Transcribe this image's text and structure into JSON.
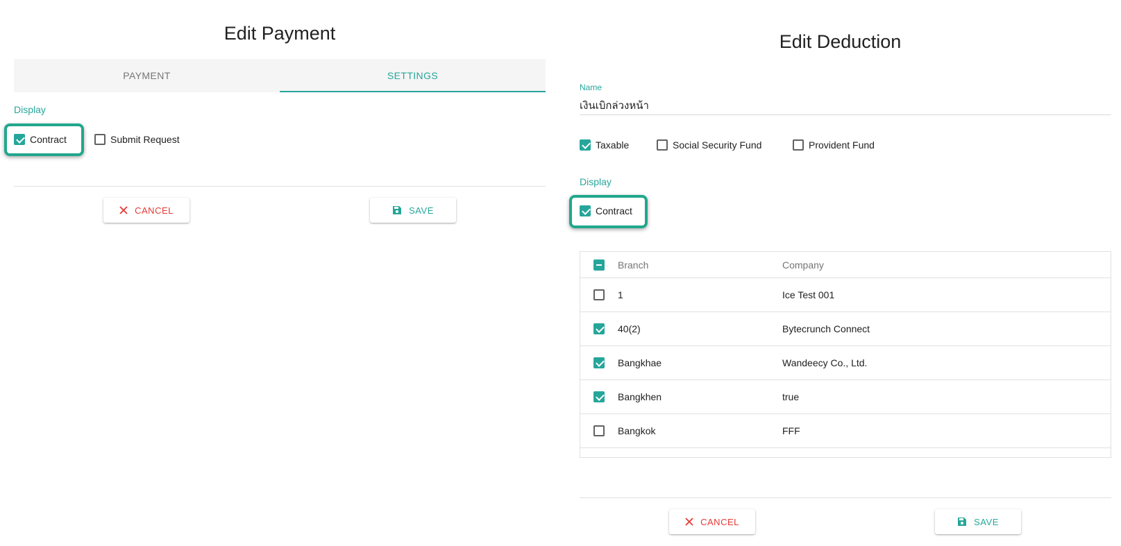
{
  "left": {
    "title": "Edit Payment",
    "tabs": [
      {
        "label": "PAYMENT",
        "active": false
      },
      {
        "label": "SETTINGS",
        "active": true
      }
    ],
    "display_label": "Display",
    "checkboxes": [
      {
        "label": "Contract",
        "checked": true
      },
      {
        "label": "Submit Request",
        "checked": false
      }
    ],
    "cancel_label": "CANCEL",
    "save_label": "SAVE"
  },
  "right": {
    "title": "Edit Deduction",
    "name_label": "Name",
    "name_value": "เงินเบิกล่วงหน้า",
    "options": [
      {
        "label": "Taxable",
        "checked": true
      },
      {
        "label": "Social Security Fund",
        "checked": false
      },
      {
        "label": "Provident Fund",
        "checked": false
      }
    ],
    "display_label": "Display",
    "display_checkbox": {
      "label": "Contract",
      "checked": true
    },
    "table": {
      "headers": [
        "Branch",
        "Company"
      ],
      "rows": [
        {
          "branch": "1",
          "company": "Ice Test 001",
          "checked": false
        },
        {
          "branch": "40(2)",
          "company": "Bytecrunch Connect",
          "checked": true
        },
        {
          "branch": "Bangkhae",
          "company": "Wandeecy Co., Ltd.",
          "checked": true
        },
        {
          "branch": "Bangkhen",
          "company": "true",
          "checked": true
        },
        {
          "branch": "Bangkok",
          "company": "FFF",
          "checked": false
        }
      ]
    },
    "cancel_label": "CANCEL",
    "save_label": "SAVE"
  },
  "colors": {
    "accent": "#26a69a",
    "danger": "#e53935",
    "highlight": "#21a78d"
  },
  "icons": {
    "cancel": "close-icon",
    "save": "floppy-disk-icon"
  }
}
